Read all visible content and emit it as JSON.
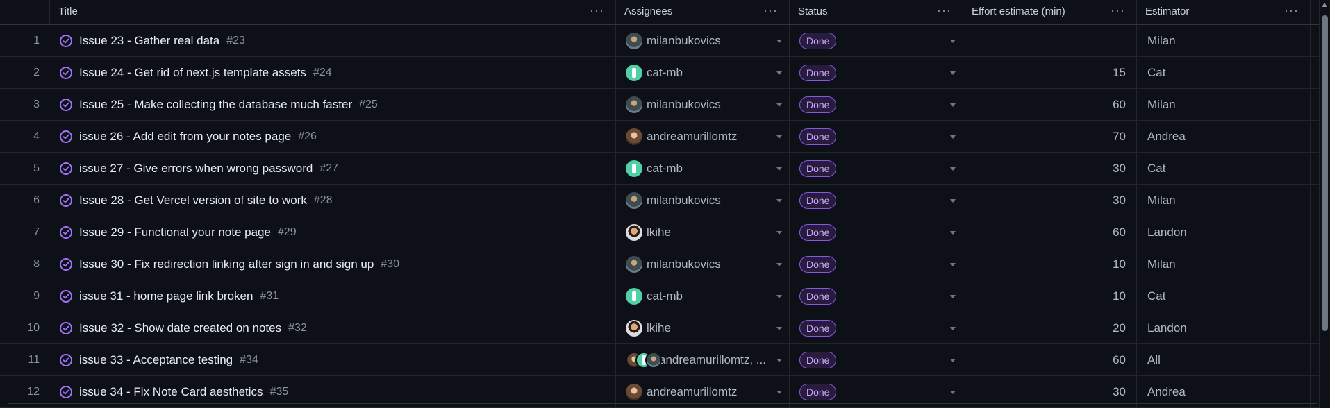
{
  "columns": {
    "title": "Title",
    "assignees": "Assignees",
    "status": "Status",
    "effort": "Effort estimate (min)",
    "estimator": "Estimator",
    "menu_glyph": "···"
  },
  "rows": [
    {
      "num": "1",
      "title": "Issue 23 - Gather real data",
      "ref": "#23",
      "assignee": "milanbukovics",
      "avatar": "milan",
      "status": "Done",
      "effort": "",
      "estimator": "Milan"
    },
    {
      "num": "2",
      "title": "Issue 24 - Get rid of next.js template assets",
      "ref": "#24",
      "assignee": "cat-mb",
      "avatar": "cat",
      "status": "Done",
      "effort": "15",
      "estimator": "Cat"
    },
    {
      "num": "3",
      "title": "Issue 25 - Make collecting the database much faster",
      "ref": "#25",
      "assignee": "milanbukovics",
      "avatar": "milan",
      "status": "Done",
      "effort": "60",
      "estimator": "Milan"
    },
    {
      "num": "4",
      "title": "issue 26 - Add edit from your notes page",
      "ref": "#26",
      "assignee": "andreamurillomtz",
      "avatar": "andrea",
      "status": "Done",
      "effort": "70",
      "estimator": "Andrea"
    },
    {
      "num": "5",
      "title": "issue 27 - Give errors when wrong password",
      "ref": "#27",
      "assignee": "cat-mb",
      "avatar": "cat",
      "status": "Done",
      "effort": "30",
      "estimator": "Cat"
    },
    {
      "num": "6",
      "title": "Issue 28 - Get Vercel version of site to work",
      "ref": "#28",
      "assignee": "milanbukovics",
      "avatar": "milan",
      "status": "Done",
      "effort": "30",
      "estimator": "Milan"
    },
    {
      "num": "7",
      "title": "Issue 29 - Functional your note page",
      "ref": "#29",
      "assignee": "lkihe",
      "avatar": "lkihe",
      "status": "Done",
      "effort": "60",
      "estimator": "Landon"
    },
    {
      "num": "8",
      "title": "Issue 30 - Fix redirection linking after sign in and sign up",
      "ref": "#30",
      "assignee": "milanbukovics",
      "avatar": "milan",
      "status": "Done",
      "effort": "10",
      "estimator": "Milan"
    },
    {
      "num": "9",
      "title": "issue 31 - home page link broken",
      "ref": "#31",
      "assignee": "cat-mb",
      "avatar": "cat",
      "status": "Done",
      "effort": "10",
      "estimator": "Cat"
    },
    {
      "num": "10",
      "title": "Issue 32 - Show date created on notes",
      "ref": "#32",
      "assignee": "lkihe",
      "avatar": "lkihe",
      "status": "Done",
      "effort": "20",
      "estimator": "Landon"
    },
    {
      "num": "11",
      "title": "issue 33 - Acceptance testing",
      "ref": "#34",
      "assignee": "andreamurillomtz, ...",
      "avatar": "multi",
      "status": "Done",
      "effort": "60",
      "estimator": "All"
    },
    {
      "num": "12",
      "title": "issue 34 - Fix Note Card aesthetics",
      "ref": "#35",
      "assignee": "andreamurillomtz",
      "avatar": "andrea",
      "status": "Done",
      "effort": "30",
      "estimator": "Andrea"
    }
  ],
  "colors": {
    "background": "#0d1117",
    "done_badge": "#8957e5",
    "status_icon": "#a371f7"
  }
}
